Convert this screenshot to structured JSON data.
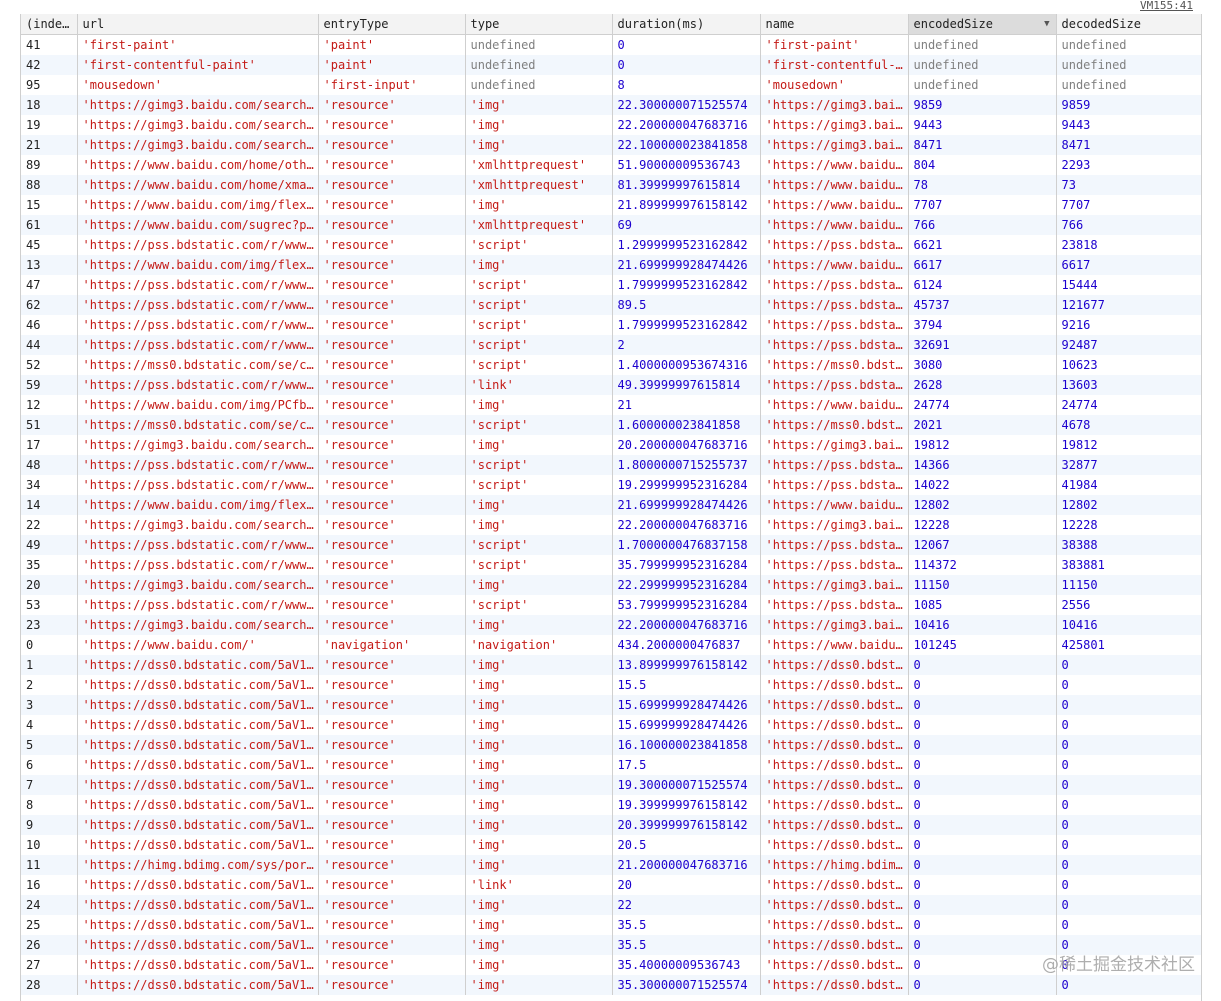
{
  "vm_link": "VM155:41",
  "watermark": "@稀土掘金技术社区",
  "columns": [
    "(inde…",
    "url",
    "entryType",
    "type",
    "duration(ms)",
    "name",
    "encodedSize",
    "decodedSize"
  ],
  "sorted_column": "encodedSize",
  "rows": [
    [
      "41",
      "'first-paint'",
      "'paint'",
      "undefined",
      "0",
      "'first-paint'",
      "undefined",
      "undefined"
    ],
    [
      "42",
      "'first-contentful-paint'",
      "'paint'",
      "undefined",
      "0",
      "'first-contentful-…",
      "undefined",
      "undefined"
    ],
    [
      "95",
      "'mousedown'",
      "'first-input'",
      "undefined",
      "8",
      "'mousedown'",
      "undefined",
      "undefined"
    ],
    [
      "18",
      "'https://gimg3.baidu.com/search…",
      "'resource'",
      "'img'",
      "22.300000071525574",
      "'https://gimg3.bai…",
      "9859",
      "9859"
    ],
    [
      "19",
      "'https://gimg3.baidu.com/search…",
      "'resource'",
      "'img'",
      "22.200000047683716",
      "'https://gimg3.bai…",
      "9443",
      "9443"
    ],
    [
      "21",
      "'https://gimg3.baidu.com/search…",
      "'resource'",
      "'img'",
      "22.100000023841858",
      "'https://gimg3.bai…",
      "8471",
      "8471"
    ],
    [
      "89",
      "'https://www.baidu.com/home/oth…",
      "'resource'",
      "'xmlhttprequest'",
      "51.90000009536743",
      "'https://www.baidu…",
      "804",
      "2293"
    ],
    [
      "88",
      "'https://www.baidu.com/home/xma…",
      "'resource'",
      "'xmlhttprequest'",
      "81.39999997615814",
      "'https://www.baidu…",
      "78",
      "73"
    ],
    [
      "15",
      "'https://www.baidu.com/img/flex…",
      "'resource'",
      "'img'",
      "21.899999976158142",
      "'https://www.baidu…",
      "7707",
      "7707"
    ],
    [
      "61",
      "'https://www.baidu.com/sugrec?p…",
      "'resource'",
      "'xmlhttprequest'",
      "69",
      "'https://www.baidu…",
      "766",
      "766"
    ],
    [
      "45",
      "'https://pss.bdstatic.com/r/www…",
      "'resource'",
      "'script'",
      "1.2999999523162842",
      "'https://pss.bdsta…",
      "6621",
      "23818"
    ],
    [
      "13",
      "'https://www.baidu.com/img/flex…",
      "'resource'",
      "'img'",
      "21.699999928474426",
      "'https://www.baidu…",
      "6617",
      "6617"
    ],
    [
      "47",
      "'https://pss.bdstatic.com/r/www…",
      "'resource'",
      "'script'",
      "1.7999999523162842",
      "'https://pss.bdsta…",
      "6124",
      "15444"
    ],
    [
      "62",
      "'https://pss.bdstatic.com/r/www…",
      "'resource'",
      "'script'",
      "89.5",
      "'https://pss.bdsta…",
      "45737",
      "121677"
    ],
    [
      "46",
      "'https://pss.bdstatic.com/r/www…",
      "'resource'",
      "'script'",
      "1.7999999523162842",
      "'https://pss.bdsta…",
      "3794",
      "9216"
    ],
    [
      "44",
      "'https://pss.bdstatic.com/r/www…",
      "'resource'",
      "'script'",
      "2",
      "'https://pss.bdsta…",
      "32691",
      "92487"
    ],
    [
      "52",
      "'https://mss0.bdstatic.com/se/c…",
      "'resource'",
      "'script'",
      "1.4000000953674316",
      "'https://mss0.bdst…",
      "3080",
      "10623"
    ],
    [
      "59",
      "'https://pss.bdstatic.com/r/www…",
      "'resource'",
      "'link'",
      "49.39999997615814",
      "'https://pss.bdsta…",
      "2628",
      "13603"
    ],
    [
      "12",
      "'https://www.baidu.com/img/PCfb…",
      "'resource'",
      "'img'",
      "21",
      "'https://www.baidu…",
      "24774",
      "24774"
    ],
    [
      "51",
      "'https://mss0.bdstatic.com/se/c…",
      "'resource'",
      "'script'",
      "1.600000023841858",
      "'https://mss0.bdst…",
      "2021",
      "4678"
    ],
    [
      "17",
      "'https://gimg3.baidu.com/search…",
      "'resource'",
      "'img'",
      "20.200000047683716",
      "'https://gimg3.bai…",
      "19812",
      "19812"
    ],
    [
      "48",
      "'https://pss.bdstatic.com/r/www…",
      "'resource'",
      "'script'",
      "1.8000000715255737",
      "'https://pss.bdsta…",
      "14366",
      "32877"
    ],
    [
      "34",
      "'https://pss.bdstatic.com/r/www…",
      "'resource'",
      "'script'",
      "19.299999952316284",
      "'https://pss.bdsta…",
      "14022",
      "41984"
    ],
    [
      "14",
      "'https://www.baidu.com/img/flex…",
      "'resource'",
      "'img'",
      "21.699999928474426",
      "'https://www.baidu…",
      "12802",
      "12802"
    ],
    [
      "22",
      "'https://gimg3.baidu.com/search…",
      "'resource'",
      "'img'",
      "22.200000047683716",
      "'https://gimg3.bai…",
      "12228",
      "12228"
    ],
    [
      "49",
      "'https://pss.bdstatic.com/r/www…",
      "'resource'",
      "'script'",
      "1.7000000476837158",
      "'https://pss.bdsta…",
      "12067",
      "38388"
    ],
    [
      "35",
      "'https://pss.bdstatic.com/r/www…",
      "'resource'",
      "'script'",
      "35.799999952316284",
      "'https://pss.bdsta…",
      "114372",
      "383881"
    ],
    [
      "20",
      "'https://gimg3.baidu.com/search…",
      "'resource'",
      "'img'",
      "22.299999952316284",
      "'https://gimg3.bai…",
      "11150",
      "11150"
    ],
    [
      "53",
      "'https://pss.bdstatic.com/r/www…",
      "'resource'",
      "'script'",
      "53.799999952316284",
      "'https://pss.bdsta…",
      "1085",
      "2556"
    ],
    [
      "23",
      "'https://gimg3.baidu.com/search…",
      "'resource'",
      "'img'",
      "22.200000047683716",
      "'https://gimg3.bai…",
      "10416",
      "10416"
    ],
    [
      "0",
      "'https://www.baidu.com/'",
      "'navigation'",
      "'navigation'",
      "434.2000000476837",
      "'https://www.baidu…",
      "101245",
      "425801"
    ],
    [
      "1",
      "'https://dss0.bdstatic.com/5aV1…",
      "'resource'",
      "'img'",
      "13.899999976158142",
      "'https://dss0.bdst…",
      "0",
      "0"
    ],
    [
      "2",
      "'https://dss0.bdstatic.com/5aV1…",
      "'resource'",
      "'img'",
      "15.5",
      "'https://dss0.bdst…",
      "0",
      "0"
    ],
    [
      "3",
      "'https://dss0.bdstatic.com/5aV1…",
      "'resource'",
      "'img'",
      "15.699999928474426",
      "'https://dss0.bdst…",
      "0",
      "0"
    ],
    [
      "4",
      "'https://dss0.bdstatic.com/5aV1…",
      "'resource'",
      "'img'",
      "15.699999928474426",
      "'https://dss0.bdst…",
      "0",
      "0"
    ],
    [
      "5",
      "'https://dss0.bdstatic.com/5aV1…",
      "'resource'",
      "'img'",
      "16.100000023841858",
      "'https://dss0.bdst…",
      "0",
      "0"
    ],
    [
      "6",
      "'https://dss0.bdstatic.com/5aV1…",
      "'resource'",
      "'img'",
      "17.5",
      "'https://dss0.bdst…",
      "0",
      "0"
    ],
    [
      "7",
      "'https://dss0.bdstatic.com/5aV1…",
      "'resource'",
      "'img'",
      "19.300000071525574",
      "'https://dss0.bdst…",
      "0",
      "0"
    ],
    [
      "8",
      "'https://dss0.bdstatic.com/5aV1…",
      "'resource'",
      "'img'",
      "19.399999976158142",
      "'https://dss0.bdst…",
      "0",
      "0"
    ],
    [
      "9",
      "'https://dss0.bdstatic.com/5aV1…",
      "'resource'",
      "'img'",
      "20.399999976158142",
      "'https://dss0.bdst…",
      "0",
      "0"
    ],
    [
      "10",
      "'https://dss0.bdstatic.com/5aV1…",
      "'resource'",
      "'img'",
      "20.5",
      "'https://dss0.bdst…",
      "0",
      "0"
    ],
    [
      "11",
      "'https://himg.bdimg.com/sys/por…",
      "'resource'",
      "'img'",
      "21.200000047683716",
      "'https://himg.bdim…",
      "0",
      "0"
    ],
    [
      "16",
      "'https://dss0.bdstatic.com/5aV1…",
      "'resource'",
      "'link'",
      "20",
      "'https://dss0.bdst…",
      "0",
      "0"
    ],
    [
      "24",
      "'https://dss0.bdstatic.com/5aV1…",
      "'resource'",
      "'img'",
      "22",
      "'https://dss0.bdst…",
      "0",
      "0"
    ],
    [
      "25",
      "'https://dss0.bdstatic.com/5aV1…",
      "'resource'",
      "'img'",
      "35.5",
      "'https://dss0.bdst…",
      "0",
      "0"
    ],
    [
      "26",
      "'https://dss0.bdstatic.com/5aV1…",
      "'resource'",
      "'img'",
      "35.5",
      "'https://dss0.bdst…",
      "0",
      "0"
    ],
    [
      "27",
      "'https://dss0.bdstatic.com/5aV1…",
      "'resource'",
      "'img'",
      "35.40000009536743",
      "'https://dss0.bdst…",
      "0",
      "0"
    ],
    [
      "28",
      "'https://dss0.bdstatic.com/5aV1…",
      "'resource'",
      "'img'",
      "35.300000071525574",
      "'https://dss0.bdst…",
      "0",
      "0"
    ]
  ]
}
